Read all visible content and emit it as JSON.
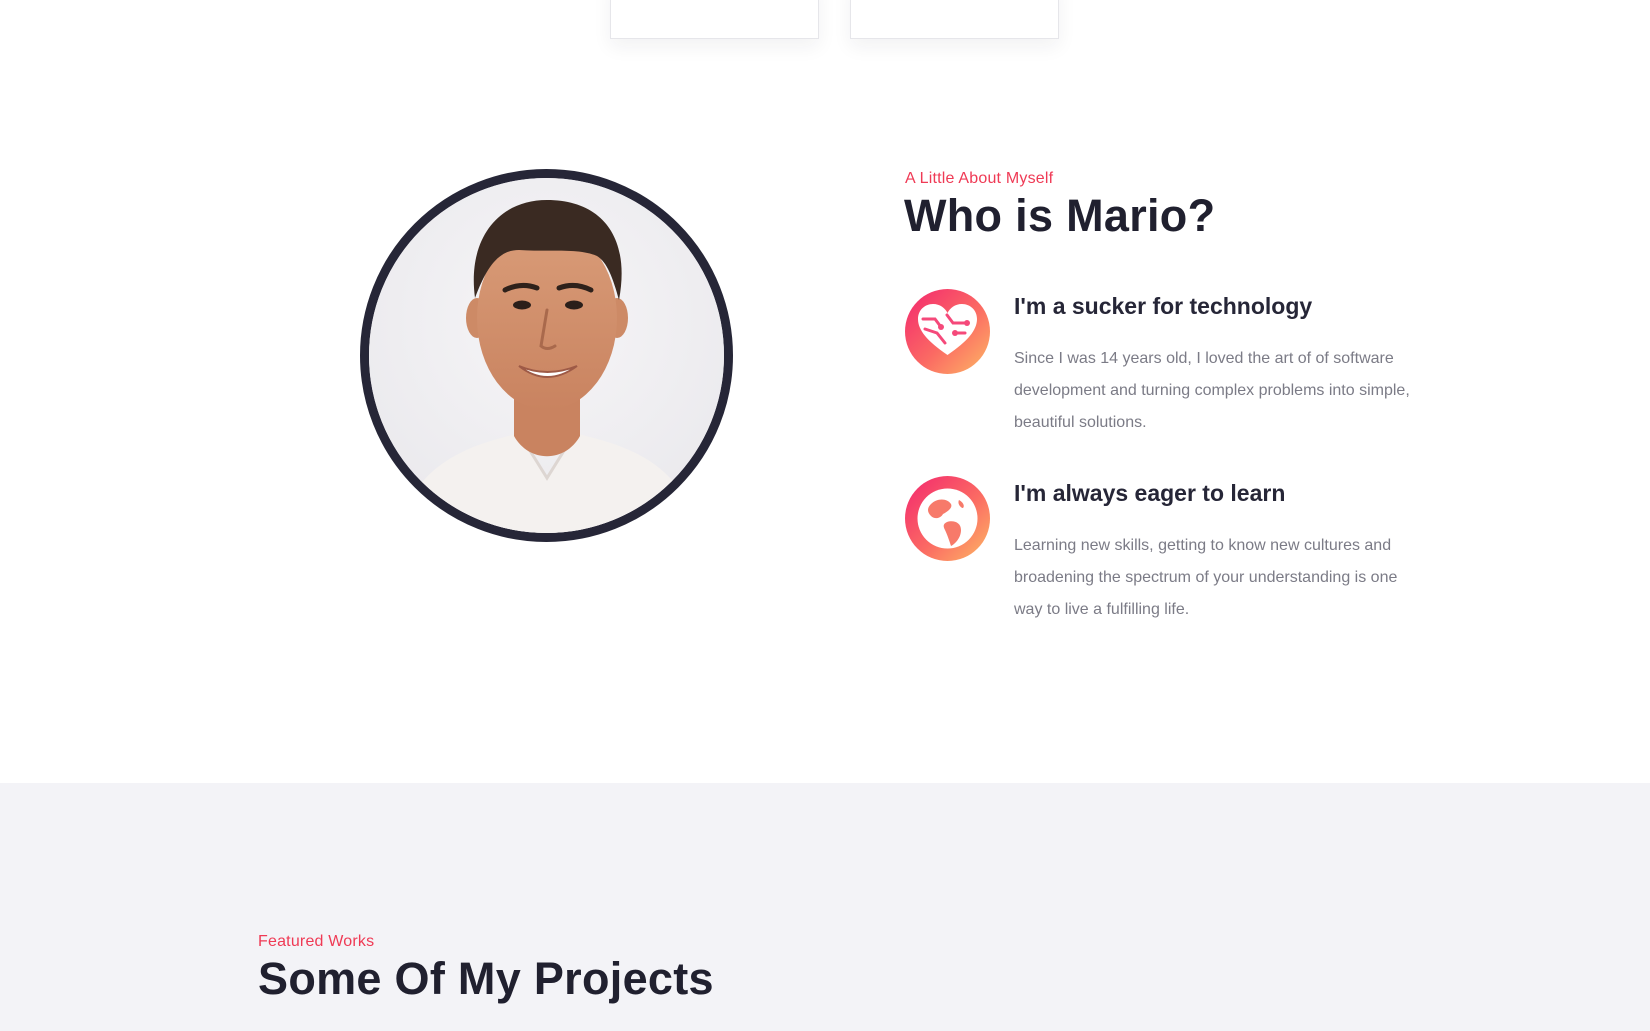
{
  "about": {
    "eyebrow": "A Little About Myself",
    "title": "Who is Mario?",
    "features": [
      {
        "icon": "tech-heart-icon",
        "heading": "I'm a sucker for technology",
        "text": "Since I was 14 years old, I loved the art of of software development and turning complex problems into simple, beautiful solutions."
      },
      {
        "icon": "globe-icon",
        "heading": "I'm always eager to learn",
        "text": "Learning new skills, getting to know new cultures and broadening the spectrum of your understanding is one way to live a fulfilling life."
      }
    ]
  },
  "projects": {
    "eyebrow": "Featured Works",
    "title": "Some Of My Projects"
  },
  "colors": {
    "accent": "#ef3a55",
    "heading": "#20202f",
    "body_text": "#7b7b86",
    "portrait_ring": "#262637",
    "section_alt_bg": "#f3f3f7",
    "icon_gradient": [
      "#f3266f",
      "#fb6a63",
      "#fdb865"
    ]
  }
}
